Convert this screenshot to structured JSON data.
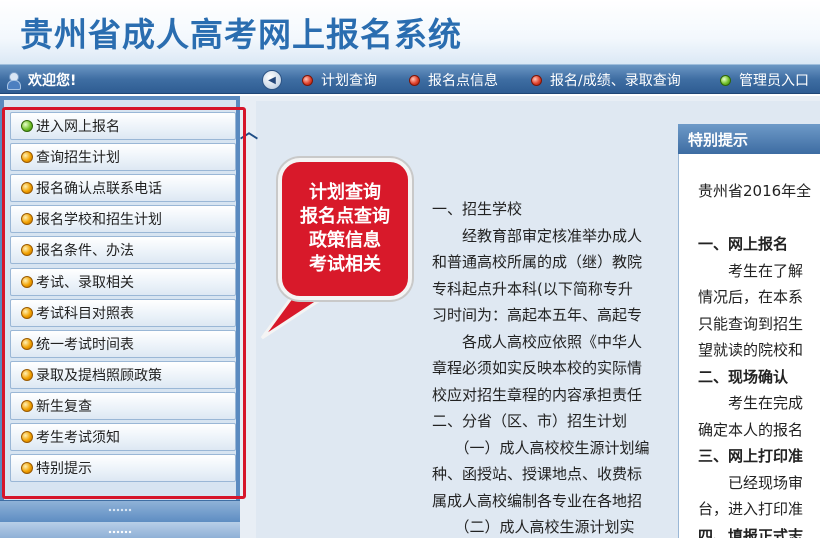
{
  "header": {
    "title": "贵州省成人高考网上报名系统"
  },
  "navbar": {
    "welcome": "欢迎您!",
    "items": [
      {
        "label": "计划查询",
        "dot": "red"
      },
      {
        "label": "报名点信息",
        "dot": "red"
      },
      {
        "label": "报名/成绩、录取查询",
        "dot": "red"
      },
      {
        "label": "管理员入口",
        "dot": "green"
      }
    ]
  },
  "sidebar": {
    "items": [
      {
        "label": "进入网上报名",
        "dot": "green"
      },
      {
        "label": "查询招生计划",
        "dot": "orange"
      },
      {
        "label": "报名确认点联系电话",
        "dot": "orange"
      },
      {
        "label": "报名学校和招生计划",
        "dot": "orange"
      },
      {
        "label": "报名条件、办法",
        "dot": "orange"
      },
      {
        "label": "考试、录取相关",
        "dot": "orange"
      },
      {
        "label": "考试科目对照表",
        "dot": "orange"
      },
      {
        "label": "统一考试时间表",
        "dot": "orange"
      },
      {
        "label": "录取及提档照顾政策",
        "dot": "orange"
      },
      {
        "label": "新生复查",
        "dot": "orange"
      },
      {
        "label": "考生考试须知",
        "dot": "orange"
      },
      {
        "label": "特别提示",
        "dot": "orange"
      }
    ]
  },
  "annotation": {
    "lines": [
      "计划查询",
      "报名点查询",
      "政策信息",
      "考试相关"
    ]
  },
  "content": {
    "lines": [
      "一、招生学校",
      "　　经教育部审定核准举办成人",
      "和普通高校所属的成（继）教院",
      "专科起点升本科(以下简称专升",
      "习时间为：高起本五年、高起专",
      "　　各成人高校应依照《中华人",
      "章程必须如实反映本校的实际情",
      "校应对招生章程的内容承担责任",
      "二、分省（区、市）招生计划",
      "　　（一）成人高校校生源计划编",
      "种、函授站、授课地点、收费标",
      "属成人高校编制各专业在各地招",
      "　　（二）成人高校生源计划实"
    ]
  },
  "notice": {
    "title": "特别提示",
    "lines": [
      {
        "text": "贵州省2016年全",
        "bold": false
      },
      {
        "text": "",
        "bold": false
      },
      {
        "text": "一、网上报名",
        "bold": true
      },
      {
        "text": "　　考生在了解",
        "bold": false
      },
      {
        "text": "情况后，在本系",
        "bold": false
      },
      {
        "text": "只能查询到招生",
        "bold": false
      },
      {
        "text": "望就读的院校和",
        "bold": false
      },
      {
        "text": "二、现场确认",
        "bold": true
      },
      {
        "text": "　　考生在完成",
        "bold": false
      },
      {
        "text": "确定本人的报名",
        "bold": false
      },
      {
        "text": "三、网上打印准",
        "bold": true
      },
      {
        "text": "　　已经现场审",
        "bold": false
      },
      {
        "text": "台，进入打印准",
        "bold": false
      },
      {
        "text": "四、填报正式志",
        "bold": true
      }
    ]
  },
  "colors": {
    "accent": "#2a6db0",
    "navbar": "#3f6ea3",
    "annotation_red": "#d6152a"
  }
}
